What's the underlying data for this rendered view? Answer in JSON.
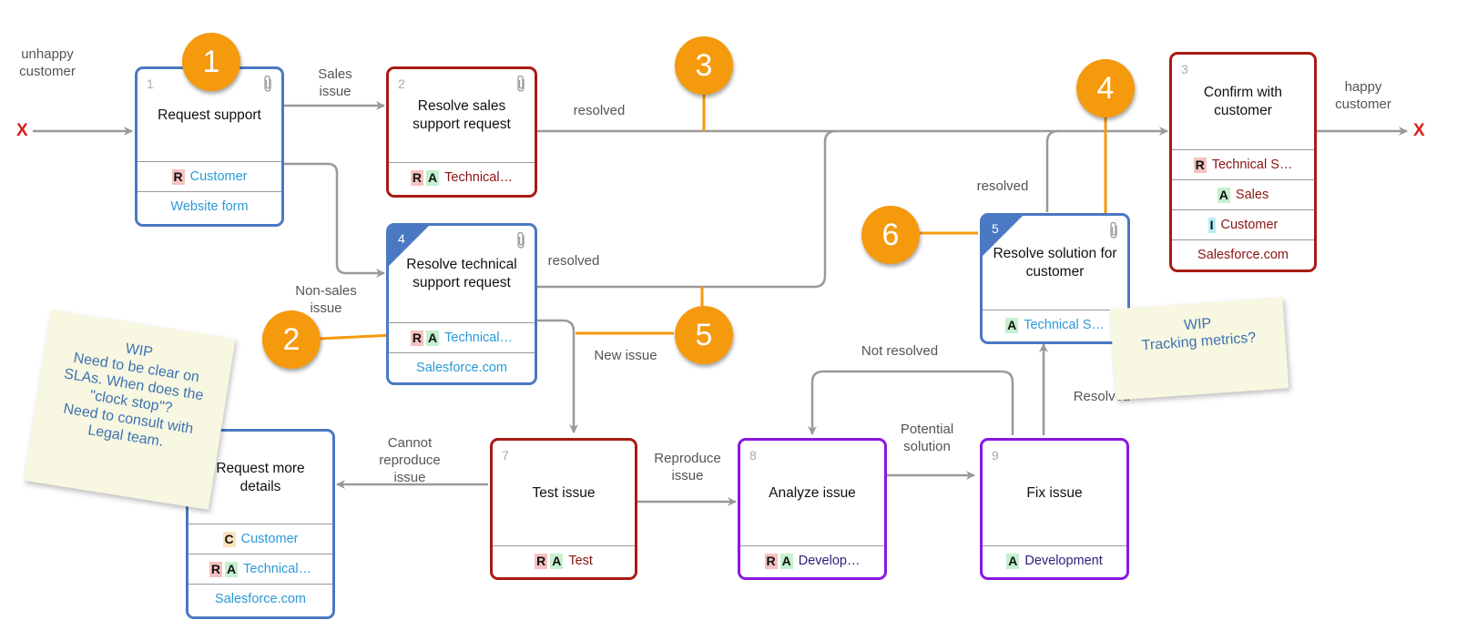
{
  "flow": {
    "start_label": "unhappy\ncustomer",
    "end_label": "happy\ncustomer",
    "start_marker": "X",
    "end_marker": "X"
  },
  "edge_labels": {
    "sales_issue": "Sales\nissue",
    "non_sales_issue": "Non-sales\nissue",
    "resolved_sales": "resolved",
    "resolved_technical": "resolved",
    "resolved_solution": "resolved",
    "new_issue": "New issue",
    "cannot_reproduce": "Cannot\nreproduce\nissue",
    "reproduce_issue": "Reproduce\nissue",
    "potential_solution": "Potential\nsolution",
    "not_resolved": "Not resolved",
    "resolved_fix": "Resolved"
  },
  "cards": [
    {
      "id": "1",
      "title": "Request support",
      "style": "blue",
      "attachment": true,
      "corner": false,
      "rows": [
        {
          "badges": [
            "R"
          ],
          "text": "Customer"
        },
        {
          "badges": [],
          "text": "Website form"
        }
      ]
    },
    {
      "id": "2",
      "title": "Resolve sales\nsupport request",
      "style": "red",
      "attachment": true,
      "corner": false,
      "rows": [
        {
          "badges": [
            "R",
            "A"
          ],
          "text": "Technical…"
        }
      ]
    },
    {
      "id": "3",
      "title": "Confirm with\ncustomer",
      "style": "red",
      "attachment": false,
      "corner": false,
      "rows": [
        {
          "badges": [
            "R"
          ],
          "text": "Technical S…"
        },
        {
          "badges": [
            "A"
          ],
          "text": "Sales"
        },
        {
          "badges": [
            "I"
          ],
          "text": "Customer"
        },
        {
          "badges": [],
          "text": "Salesforce.com"
        }
      ]
    },
    {
      "id": "4",
      "title": "Resolve technical\nsupport request",
      "style": "blue",
      "attachment": true,
      "corner": true,
      "rows": [
        {
          "badges": [
            "R",
            "A"
          ],
          "text": "Technical…"
        },
        {
          "badges": [],
          "text": "Salesforce.com"
        }
      ]
    },
    {
      "id": "5",
      "title": "Resolve solution for\ncustomer",
      "style": "blue",
      "attachment": true,
      "corner": true,
      "rows": [
        {
          "badges": [
            "A"
          ],
          "text": "Technical S…"
        }
      ]
    },
    {
      "id": "",
      "title": "Request more\ndetails",
      "style": "blue",
      "attachment": false,
      "corner": false,
      "rows": [
        {
          "badges": [
            "C"
          ],
          "text": "Customer"
        },
        {
          "badges": [
            "R",
            "A"
          ],
          "text": "Technical…"
        },
        {
          "badges": [],
          "text": "Salesforce.com"
        }
      ]
    },
    {
      "id": "7",
      "title": "Test issue",
      "style": "red",
      "attachment": false,
      "corner": false,
      "rows": [
        {
          "badges": [
            "R",
            "A"
          ],
          "text": "Test"
        }
      ]
    },
    {
      "id": "8",
      "title": "Analyze issue",
      "style": "purple",
      "attachment": false,
      "corner": false,
      "rows": [
        {
          "badges": [
            "R",
            "A"
          ],
          "text": "Develop…"
        }
      ]
    },
    {
      "id": "9",
      "title": "Fix issue",
      "style": "purple",
      "attachment": false,
      "corner": false,
      "rows": [
        {
          "badges": [
            "A"
          ],
          "text": "Development"
        }
      ]
    }
  ],
  "markers": [
    "1",
    "2",
    "3",
    "4",
    "5",
    "6"
  ],
  "notes": [
    {
      "text": "WIP\nNeed to be clear on\nSLAs. When does the\n\"clock stop\"?\nNeed to consult with\nLegal team."
    },
    {
      "text": "WIP\nTracking metrics?"
    }
  ],
  "colors": {
    "blue": "#4a78c2",
    "red": "#a81b13",
    "purple": "#8a16e0",
    "marker": "#f59a0d",
    "link": "#999999"
  }
}
